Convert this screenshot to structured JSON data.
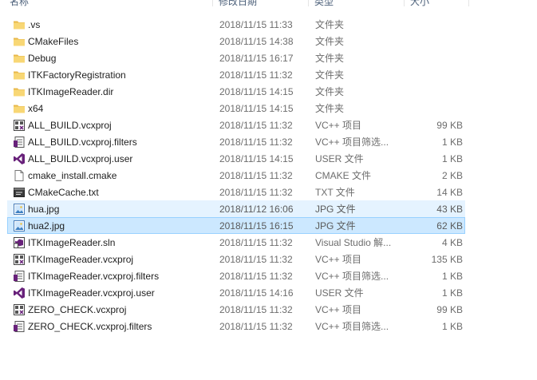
{
  "header": {
    "name": "名称",
    "date": "修改日期",
    "type": "类型",
    "size": "大小"
  },
  "files": [
    {
      "name": ".vs",
      "date": "2018/11/15 11:33",
      "type": "文件夹",
      "size": "",
      "icon": "folder-icon"
    },
    {
      "name": "CMakeFiles",
      "date": "2018/11/15 14:38",
      "type": "文件夹",
      "size": "",
      "icon": "folder-icon"
    },
    {
      "name": "Debug",
      "date": "2018/11/15 16:17",
      "type": "文件夹",
      "size": "",
      "icon": "folder-icon"
    },
    {
      "name": "ITKFactoryRegistration",
      "date": "2018/11/15 11:32",
      "type": "文件夹",
      "size": "",
      "icon": "folder-icon"
    },
    {
      "name": "ITKImageReader.dir",
      "date": "2018/11/15 14:15",
      "type": "文件夹",
      "size": "",
      "icon": "folder-icon"
    },
    {
      "name": "x64",
      "date": "2018/11/15 14:15",
      "type": "文件夹",
      "size": "",
      "icon": "folder-icon"
    },
    {
      "name": "ALL_BUILD.vcxproj",
      "date": "2018/11/15 11:32",
      "type": "VC++ 项目",
      "size": "99 KB",
      "icon": "vcxproj-icon"
    },
    {
      "name": "ALL_BUILD.vcxproj.filters",
      "date": "2018/11/15 11:32",
      "type": "VC++ 项目筛选...",
      "size": "1 KB",
      "icon": "filters-icon"
    },
    {
      "name": "ALL_BUILD.vcxproj.user",
      "date": "2018/11/15 14:15",
      "type": "USER 文件",
      "size": "1 KB",
      "icon": "visual-studio-icon"
    },
    {
      "name": "cmake_install.cmake",
      "date": "2018/11/15 11:32",
      "type": "CMAKE 文件",
      "size": "2 KB",
      "icon": "document-icon"
    },
    {
      "name": "CMakeCache.txt",
      "date": "2018/11/15 11:32",
      "type": "TXT 文件",
      "size": "14 KB",
      "icon": "text-file-icon"
    },
    {
      "name": "hua.jpg",
      "date": "2018/11/12 16:06",
      "type": "JPG 文件",
      "size": "43 KB",
      "icon": "image-file-icon",
      "state": "hover"
    },
    {
      "name": "hua2.jpg",
      "date": "2018/11/15 16:15",
      "type": "JPG 文件",
      "size": "62 KB",
      "icon": "image-file-icon",
      "state": "selected"
    },
    {
      "name": "ITKImageReader.sln",
      "date": "2018/11/15 11:32",
      "type": "Visual Studio 解...",
      "size": "4 KB",
      "icon": "solution-icon"
    },
    {
      "name": "ITKImageReader.vcxproj",
      "date": "2018/11/15 11:32",
      "type": "VC++ 项目",
      "size": "135 KB",
      "icon": "vcxproj-icon"
    },
    {
      "name": "ITKImageReader.vcxproj.filters",
      "date": "2018/11/15 11:32",
      "type": "VC++ 项目筛选...",
      "size": "1 KB",
      "icon": "filters-icon"
    },
    {
      "name": "ITKImageReader.vcxproj.user",
      "date": "2018/11/15 14:16",
      "type": "USER 文件",
      "size": "1 KB",
      "icon": "visual-studio-icon"
    },
    {
      "name": "ZERO_CHECK.vcxproj",
      "date": "2018/11/15 11:32",
      "type": "VC++ 项目",
      "size": "99 KB",
      "icon": "vcxproj-icon"
    },
    {
      "name": "ZERO_CHECK.vcxproj.filters",
      "date": "2018/11/15 11:32",
      "type": "VC++ 项目筛选...",
      "size": "1 KB",
      "icon": "filters-icon"
    }
  ],
  "colors": {
    "folder": "#f7d674",
    "vs_purple": "#68217a",
    "hover_bg": "#e5f3ff",
    "selected_bg": "#cce8ff",
    "selected_border": "#99d1ff"
  }
}
